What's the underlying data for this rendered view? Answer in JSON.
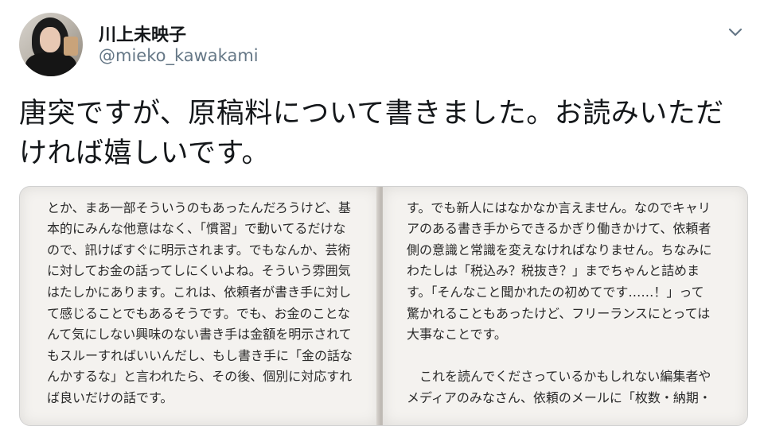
{
  "author": {
    "display_name": "川上未映子",
    "handle": "@mieko_kawakami"
  },
  "tweet": {
    "text": "唐突ですが、原稿料について書きました。お読みいただければ嬉しいです。"
  },
  "icons": {
    "menu": "chevron-down-icon"
  },
  "media": {
    "left_page_lines": [
      "",
      "とか、まあ一部そういうのもあったんだろうけど、基",
      "本的にみんな他意はなく、「慣習」で動いてるだけな",
      "ので、訊けばすぐに明示されます。でもなんか、芸術",
      "に対してお金の話ってしにくいよね。そういう雰囲気",
      "はたしかにあります。これは、依頼者が書き手に対し",
      "て感じることでもあるそうです。でも、お金のことな",
      "んて気にしない興味のない書き手は金額を明示されて",
      "もスルーすればいいんだし、もし書き手に「金の話な",
      "んかするな」と言われたら、その後、個別に対応すれ",
      "ば良いだけの話です。"
    ],
    "right_page_lines": [
      "",
      "す。でも新人にはなかなか言えません。なのでキャリ",
      "アのある書き手からできるかぎり働きかけて、依頼者",
      "側の意識と常識を変えなければなりません。ちなみに",
      "わたしは「税込み？税抜き？」までちゃんと詰めま",
      "す。「そんなこと聞かれたの初めてです……！」って",
      "驚かれることもあったけど、フリーランスにとっては",
      "大事なことです。",
      "",
      "　これを読んでくださっているかもしれない編集者や",
      "メディアのみなさん、依頼のメールに「枚数・納期・",
      ""
    ]
  }
}
